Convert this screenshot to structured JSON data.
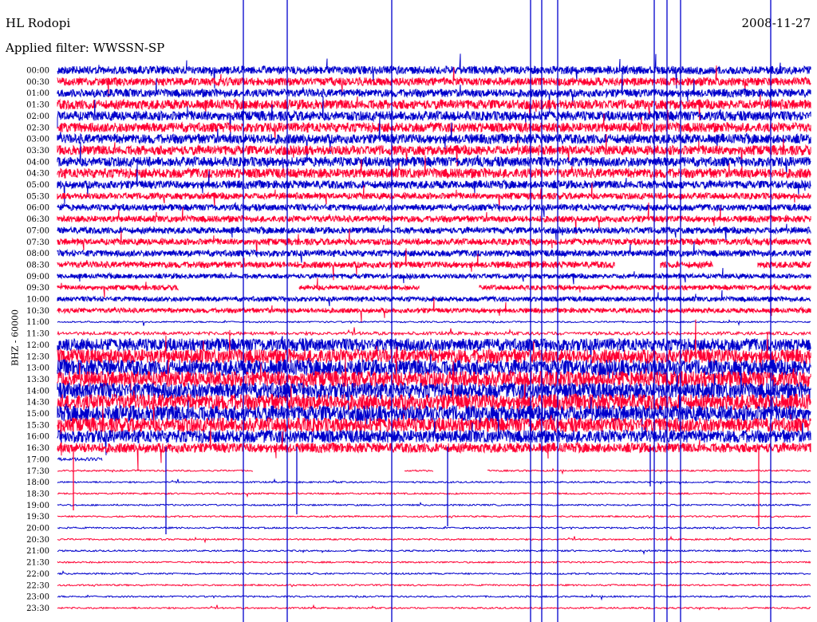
{
  "header": {
    "station": "HL Rodopi",
    "filter": "Applied filter: WWSSN-SP",
    "date": "2008-11-27"
  },
  "chart_data": {
    "type": "line",
    "title": "HL Rodopi",
    "subtitle": "Applied filter: WWSSN-SP",
    "ylabel": "BHZ - 60000",
    "xlabel": "",
    "row_labels": [
      "00:00",
      "00:30",
      "01:00",
      "01:30",
      "02:00",
      "02:30",
      "03:00",
      "03:30",
      "04:00",
      "04:30",
      "05:00",
      "05:30",
      "06:00",
      "06:30",
      "07:00",
      "07:30",
      "08:00",
      "08:30",
      "09:00",
      "09:30",
      "10:00",
      "10:30",
      "11:00",
      "11:30",
      "12:00",
      "12:30",
      "13:00",
      "13:30",
      "14:00",
      "14:30",
      "15:00",
      "15:30",
      "16:00",
      "16:30",
      "17:00",
      "17:30",
      "18:00",
      "18:30",
      "19:00",
      "19:30",
      "20:00",
      "20:30",
      "21:00",
      "21:30",
      "22:00",
      "22:30",
      "23:00",
      "23:30"
    ],
    "trace_colors": [
      "#0000cc",
      "#ff0033"
    ],
    "row_amplitude": [
      5,
      5,
      5,
      6,
      6,
      6,
      6,
      6,
      6,
      6,
      5,
      4,
      4,
      4,
      4,
      4,
      4,
      4,
      3,
      3,
      3,
      3,
      1,
      2,
      8,
      9,
      10,
      10,
      10,
      10,
      10,
      9,
      8,
      6,
      2,
      1,
      1,
      1,
      1,
      1,
      1,
      1,
      1,
      1,
      1,
      1,
      1,
      1
    ],
    "data_gaps": [
      {
        "row": "09:30",
        "from": 0.16,
        "to": 0.32
      },
      {
        "row": "09:30",
        "from": 0.48,
        "to": 0.56
      },
      {
        "row": "08:30",
        "from": 0.74,
        "to": 0.8
      },
      {
        "row": "08:30",
        "from": 0.87,
        "to": 0.93
      },
      {
        "row": "17:30",
        "from": 0.26,
        "to": 0.46
      },
      {
        "row": "17:30",
        "from": 0.5,
        "to": 0.57
      },
      {
        "row": "17:00",
        "from": 0.06,
        "to": 1.0
      }
    ],
    "grid": false
  }
}
